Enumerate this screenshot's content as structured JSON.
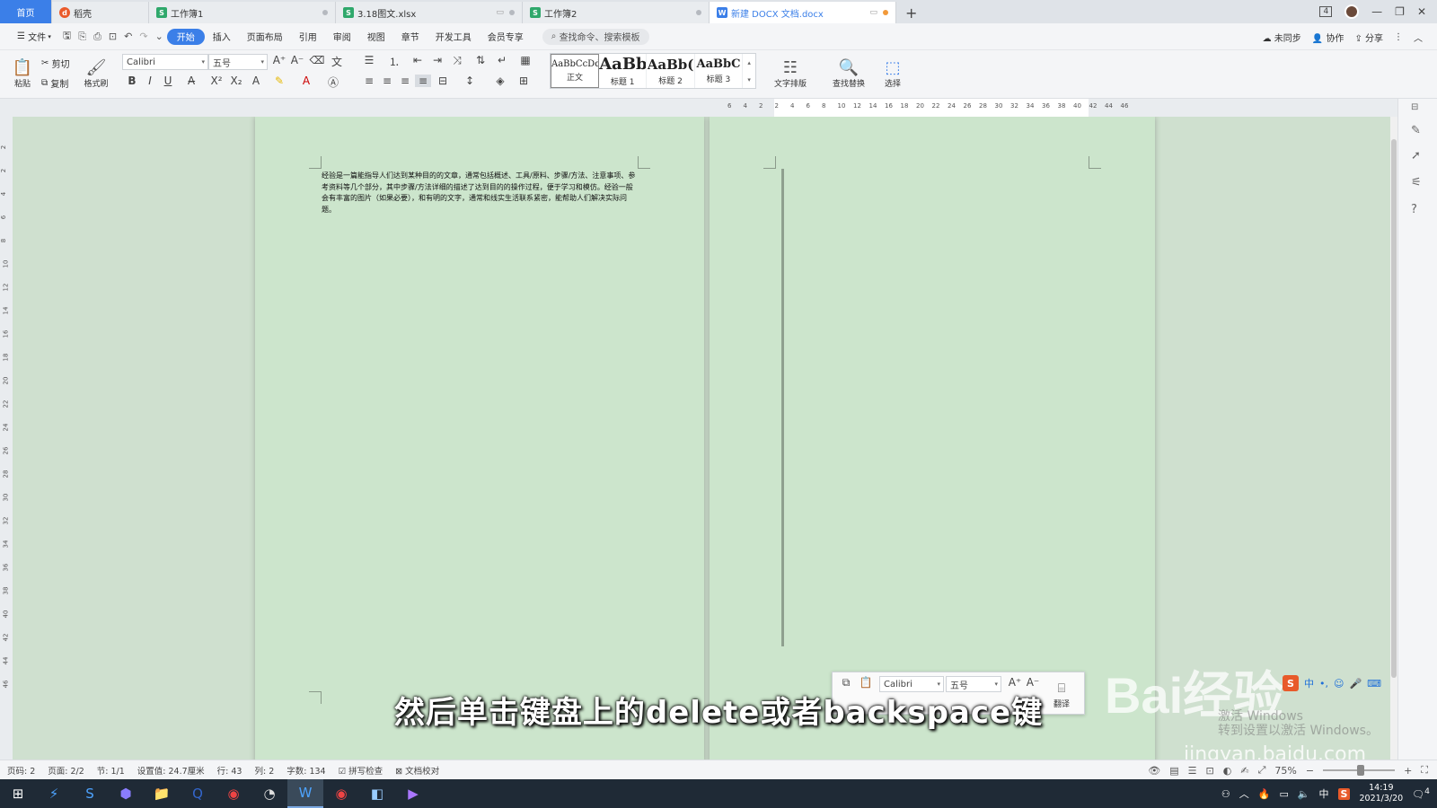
{
  "tabs": [
    {
      "label": "首页",
      "kind": "home"
    },
    {
      "label": "稻壳",
      "icon": "docer-icon"
    },
    {
      "label": "工作簿1",
      "icon": "spreadsheet-icon"
    },
    {
      "label": "3.18图文.xlsx",
      "icon": "spreadsheet-icon"
    },
    {
      "label": "工作簿2",
      "icon": "spreadsheet-icon"
    },
    {
      "label": "新建 DOCX 文档.docx",
      "icon": "document-icon",
      "active": true
    }
  ],
  "tab_icon_letters": {
    "s": "S",
    "w": "W",
    "d": "d"
  },
  "menu": {
    "file": "文件",
    "items": [
      "开始",
      "插入",
      "页面布局",
      "引用",
      "审阅",
      "视图",
      "章节",
      "开发工具",
      "会员专享"
    ],
    "active": "开始",
    "search": "查找命令、搜索模板",
    "right": [
      "未同步",
      "协作",
      "分享"
    ]
  },
  "ribbon": {
    "paste": "粘贴",
    "cut": "剪切",
    "copy": "复制",
    "format_painter": "格式刷",
    "font": "Calibri",
    "size": "五号",
    "styles": [
      {
        "preview": "AaBbCcDd",
        "name": "正文"
      },
      {
        "preview": "AaBb",
        "name": "标题 1"
      },
      {
        "preview": "AaBb(",
        "name": "标题 2"
      },
      {
        "preview": "AaBbC",
        "name": "标题 3"
      }
    ],
    "text_layout": "文字排版",
    "find_replace": "查找替换",
    "select": "选择"
  },
  "ruler_numbers": [
    "6",
    "4",
    "2",
    "2",
    "4",
    "6",
    "8",
    "10",
    "12",
    "14",
    "16",
    "18",
    "20",
    "22",
    "24",
    "26",
    "28",
    "30",
    "32",
    "34",
    "36",
    "38",
    "40",
    "42",
    "44",
    "46"
  ],
  "vruler_numbers": [
    "2",
    "2",
    "4",
    "6",
    "8",
    "10",
    "12",
    "14",
    "16",
    "18",
    "20",
    "22",
    "24",
    "26",
    "28",
    "30",
    "32",
    "34",
    "36",
    "38",
    "40",
    "42",
    "44",
    "46"
  ],
  "document": {
    "text": "经验是一篇能指导人们达到某种目的的文章，通常包括概述、工具/原料、步骤/方法、注意事项、参考资料等几个部分，其中步骤/方法详细的描述了达到目的的操作过程，便于学习和模仿。经验一般会有丰富的图片（如果必要），和有明的文字，通常和线实生活联系紧密，能帮助人们解决实际问题。"
  },
  "minibar": {
    "font": "Calibri",
    "size": "五号",
    "translate": "翻译"
  },
  "subtitle": "然后单击键盘上的delete或者backspace键",
  "watermark": {
    "brand": "Bai经验",
    "url": "jingyan.baidu.com"
  },
  "activate": "激活 Windows\n转到设置以激活 Windows。",
  "status": [
    "页码: 2",
    "页面: 2/2",
    "节: 1/1",
    "设置值: 24.7厘米",
    "行: 43",
    "列: 2",
    "字数: 134",
    "拼写检查",
    "文档校对"
  ],
  "zoom": "75%",
  "ime": [
    "中",
    "•,",
    "☺",
    "🎤",
    "⌨"
  ],
  "clock": {
    "time": "14:19",
    "date": "2021/3/20"
  },
  "tray": [
    "中"
  ],
  "notif_count": "4",
  "window_count": "4"
}
